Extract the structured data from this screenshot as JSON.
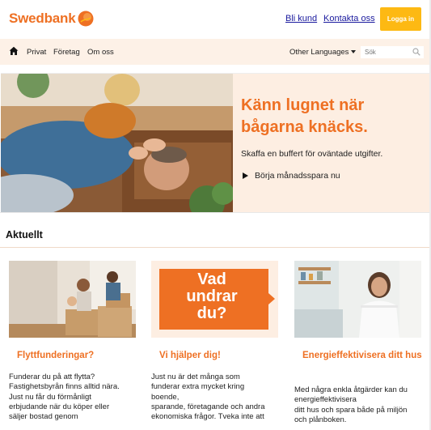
{
  "header": {
    "logo_text": "Swedbank",
    "links": [
      "Bli kund",
      "Kontakta oss"
    ],
    "login_label": "Logga in"
  },
  "nav": {
    "items": [
      "Privat",
      "Företag",
      "Om oss"
    ],
    "language_label": "Other Languages",
    "search_placeholder": "Sök"
  },
  "hero": {
    "title": "Känn lugnet när bågarna knäcks.",
    "subtitle": "Skaffa en buffert för oväntade utgifter.",
    "cta_label": "Börja månadsspara nu"
  },
  "section": {
    "title": "Aktuellt"
  },
  "cards": [
    {
      "title": "Flyttfunderingar?",
      "body": [
        "Funderar du på att flytta?",
        "Fastighetsbyrån finns alltid nära.",
        "Just nu får du förmånligt",
        "erbjudande när du köper eller",
        "säljer bostad genom"
      ]
    },
    {
      "image_text": [
        "Vad",
        "undrar",
        "du?"
      ],
      "title": "Vi hjälper dig!",
      "body": [
        "Just nu är det många som",
        "funderar extra mycket kring",
        "boende,",
        "sparande, företagande och andra",
        "ekonomiska frågor. Tveka inte att"
      ]
    },
    {
      "title": "Energieffektivisera ditt hus",
      "body": [
        "Med några enkla åtgärder kan du",
        "energieffektivisera",
        "ditt hus och spara både på miljön",
        "och plånboken."
      ]
    }
  ],
  "colors": {
    "brand_orange": "#ee7023",
    "login_yellow": "#fdb913",
    "nav_bg": "#fdf1e7",
    "hero_bg": "#fdeee2"
  }
}
